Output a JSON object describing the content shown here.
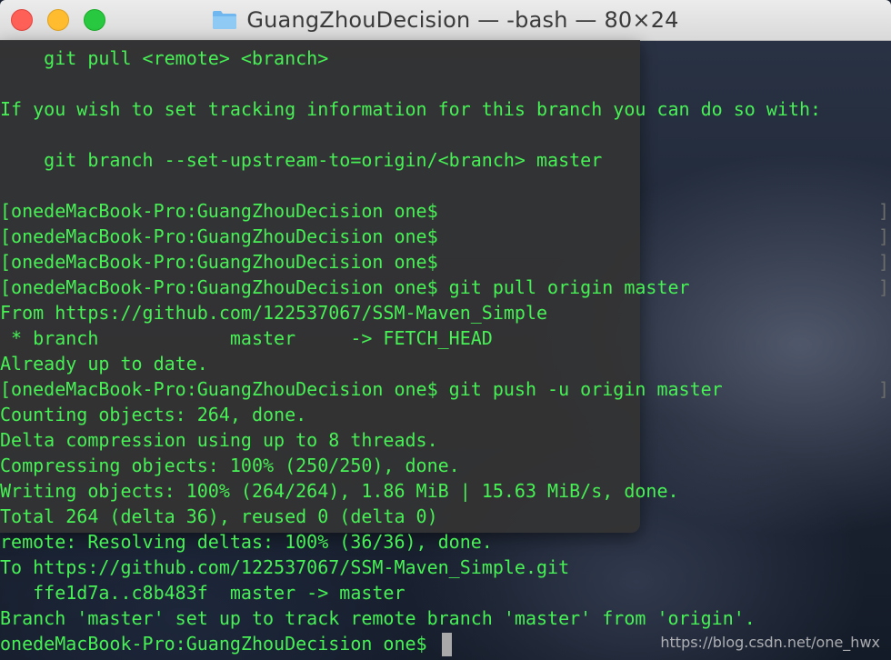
{
  "window": {
    "title": "GuangZhouDecision — -bash — 80×24",
    "folder_icon": "folder-icon"
  },
  "colors": {
    "terminal_text": "#47f055",
    "overlay_bg": "#343434",
    "cursor": "#a9a9a9"
  },
  "terminal": {
    "lines": [
      "    git pull <remote> <branch>",
      "",
      "If you wish to set tracking information for this branch you can do so with:",
      "",
      "    git branch --set-upstream-to=origin/<branch> master",
      "",
      "[onedeMacBook-Pro:GuangZhouDecision one$",
      "[onedeMacBook-Pro:GuangZhouDecision one$",
      "[onedeMacBook-Pro:GuangZhouDecision one$",
      "[onedeMacBook-Pro:GuangZhouDecision one$ git pull origin master",
      "From https://github.com/122537067/SSM-Maven_Simple",
      " * branch            master     -> FETCH_HEAD",
      "Already up to date.",
      "[onedeMacBook-Pro:GuangZhouDecision one$ git push -u origin master",
      "Counting objects: 264, done.",
      "Delta compression using up to 8 threads.",
      "Compressing objects: 100% (250/250), done.",
      "Writing objects: 100% (264/264), 1.86 MiB | 15.63 MiB/s, done.",
      "Total 264 (delta 36), reused 0 (delta 0)",
      "remote: Resolving deltas: 100% (36/36), done.",
      "To https://github.com/122537067/SSM-Maven_Simple.git",
      "   ffe1d7a..c8b483f  master -> master",
      "Branch 'master' set up to track remote branch 'master' from 'origin'.",
      "onedeMacBook-Pro:GuangZhouDecision one$"
    ],
    "right_bracket": "]"
  },
  "watermark": "https://blog.csdn.net/one_hwx"
}
